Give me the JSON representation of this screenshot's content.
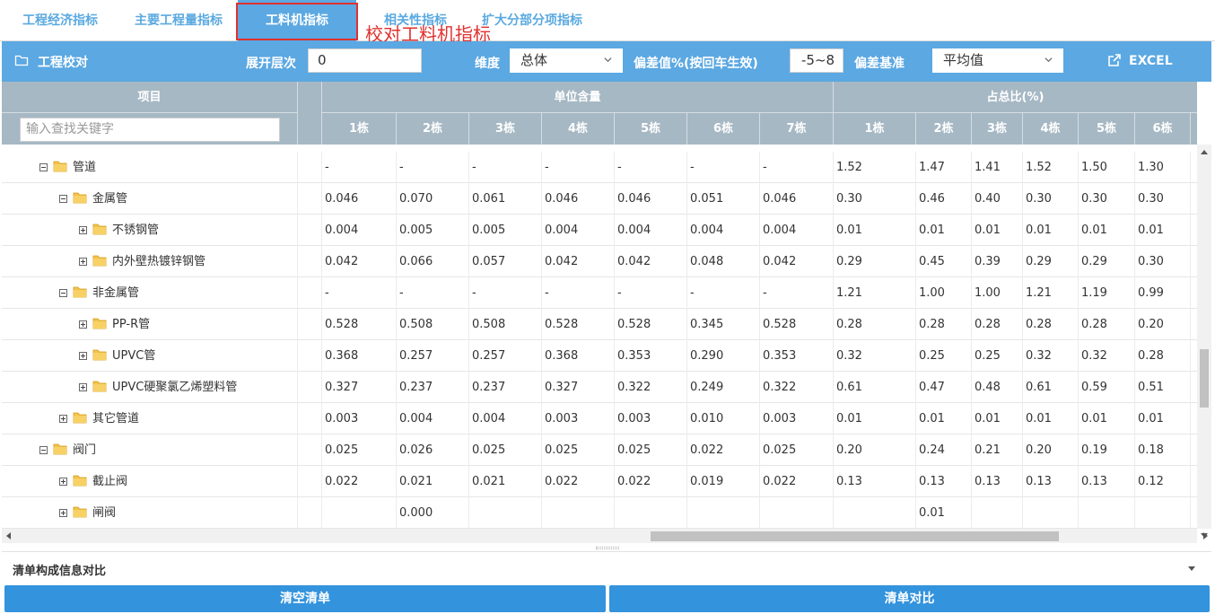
{
  "tabs": [
    {
      "label": "工程经济指标",
      "active": false
    },
    {
      "label": "主要工程量指标",
      "active": false
    },
    {
      "label": "工料机指标",
      "active": true
    },
    {
      "label": "相关性指标",
      "active": false
    },
    {
      "label": "扩大分部分项指标",
      "active": false
    }
  ],
  "annotation": "校对工料机指标",
  "toolbar": {
    "title": "工程校对",
    "expand_label": "展开层次",
    "expand_value": "0",
    "dimension_label": "维度",
    "dimension_value": "总体",
    "deviation_label": "偏差值%(按回车生效)",
    "deviation_value": "-5~8",
    "basis_label": "偏差基准",
    "basis_value": "平均值",
    "excel_label": "EXCEL"
  },
  "grid": {
    "col_item": "项目",
    "group_unit": "单位含量",
    "group_pct": "占总比(%)",
    "search_placeholder": "输入查找关键字",
    "unit_cols": [
      "1栋",
      "2栋",
      "3栋",
      "4栋",
      "5栋",
      "6栋",
      "7栋"
    ],
    "pct_cols": [
      "1栋",
      "2栋",
      "3栋",
      "4栋",
      "5栋",
      "6栋"
    ],
    "rows": [
      {
        "level": 0,
        "expanded": true,
        "name": "管道",
        "unit": [
          "-",
          "-",
          "-",
          "-",
          "-",
          "-",
          "-"
        ],
        "pct": [
          "1.52",
          "1.47",
          "1.41",
          "1.52",
          "1.50",
          "1.30"
        ]
      },
      {
        "level": 1,
        "expanded": true,
        "name": "金属管",
        "unit": [
          "0.046",
          "0.070",
          "0.061",
          "0.046",
          "0.046",
          "0.051",
          "0.046"
        ],
        "pct": [
          "0.30",
          "0.46",
          "0.40",
          "0.30",
          "0.30",
          "0.30"
        ]
      },
      {
        "level": 2,
        "expanded": false,
        "name": "不锈钢管",
        "unit": [
          "0.004",
          "0.005",
          "0.005",
          "0.004",
          "0.004",
          "0.004",
          "0.004"
        ],
        "pct": [
          "0.01",
          "0.01",
          "0.01",
          "0.01",
          "0.01",
          "0.01"
        ]
      },
      {
        "level": 2,
        "expanded": false,
        "name": "内外壁热镀锌钢管",
        "unit": [
          "0.042",
          "0.066",
          "0.057",
          "0.042",
          "0.042",
          "0.048",
          "0.042"
        ],
        "pct": [
          "0.29",
          "0.45",
          "0.39",
          "0.29",
          "0.29",
          "0.30"
        ]
      },
      {
        "level": 1,
        "expanded": true,
        "name": "非金属管",
        "unit": [
          "-",
          "-",
          "-",
          "-",
          "-",
          "-",
          "-"
        ],
        "pct": [
          "1.21",
          "1.00",
          "1.00",
          "1.21",
          "1.19",
          "0.99"
        ]
      },
      {
        "level": 2,
        "expanded": false,
        "name": "PP-R管",
        "unit": [
          "0.528",
          "0.508",
          "0.508",
          "0.528",
          "0.528",
          "0.345",
          "0.528"
        ],
        "pct": [
          "0.28",
          "0.28",
          "0.28",
          "0.28",
          "0.28",
          "0.20"
        ]
      },
      {
        "level": 2,
        "expanded": false,
        "name": "UPVC管",
        "unit": [
          "0.368",
          "0.257",
          "0.257",
          "0.368",
          "0.353",
          "0.290",
          "0.353"
        ],
        "pct": [
          "0.32",
          "0.25",
          "0.25",
          "0.32",
          "0.32",
          "0.28"
        ]
      },
      {
        "level": 2,
        "expanded": false,
        "name": "UPVC硬聚氯乙烯塑料管",
        "unit": [
          "0.327",
          "0.237",
          "0.237",
          "0.327",
          "0.322",
          "0.249",
          "0.322"
        ],
        "pct": [
          "0.61",
          "0.47",
          "0.48",
          "0.61",
          "0.59",
          "0.51"
        ]
      },
      {
        "level": 1,
        "expanded": false,
        "name": "其它管道",
        "unit": [
          "0.003",
          "0.004",
          "0.004",
          "0.003",
          "0.003",
          "0.010",
          "0.003"
        ],
        "pct": [
          "0.01",
          "0.01",
          "0.01",
          "0.01",
          "0.01",
          "0.01"
        ]
      },
      {
        "level": 0,
        "expanded": true,
        "name": "阀门",
        "unit": [
          "0.025",
          "0.026",
          "0.025",
          "0.025",
          "0.025",
          "0.022",
          "0.025"
        ],
        "pct": [
          "0.20",
          "0.24",
          "0.21",
          "0.20",
          "0.19",
          "0.18"
        ]
      },
      {
        "level": 1,
        "expanded": false,
        "name": "截止阀",
        "unit": [
          "0.022",
          "0.021",
          "0.021",
          "0.022",
          "0.022",
          "0.019",
          "0.022"
        ],
        "pct": [
          "0.13",
          "0.13",
          "0.13",
          "0.13",
          "0.13",
          "0.12"
        ]
      },
      {
        "level": 1,
        "expanded": false,
        "name": "闸阀",
        "unit": [
          "",
          "0.000",
          "",
          "",
          "",
          "",
          ""
        ],
        "pct": [
          "",
          "0.01",
          "",
          "",
          "",
          ""
        ]
      }
    ]
  },
  "bottom": {
    "panel_title": "清单构成信息对比",
    "clear_label": "清空清单",
    "compare_label": "清单对比"
  },
  "colors": {
    "accent": "#5ba8e2",
    "header_bg": "#a6b8c4",
    "button": "#3393dd",
    "annotation": "#e0312f"
  }
}
